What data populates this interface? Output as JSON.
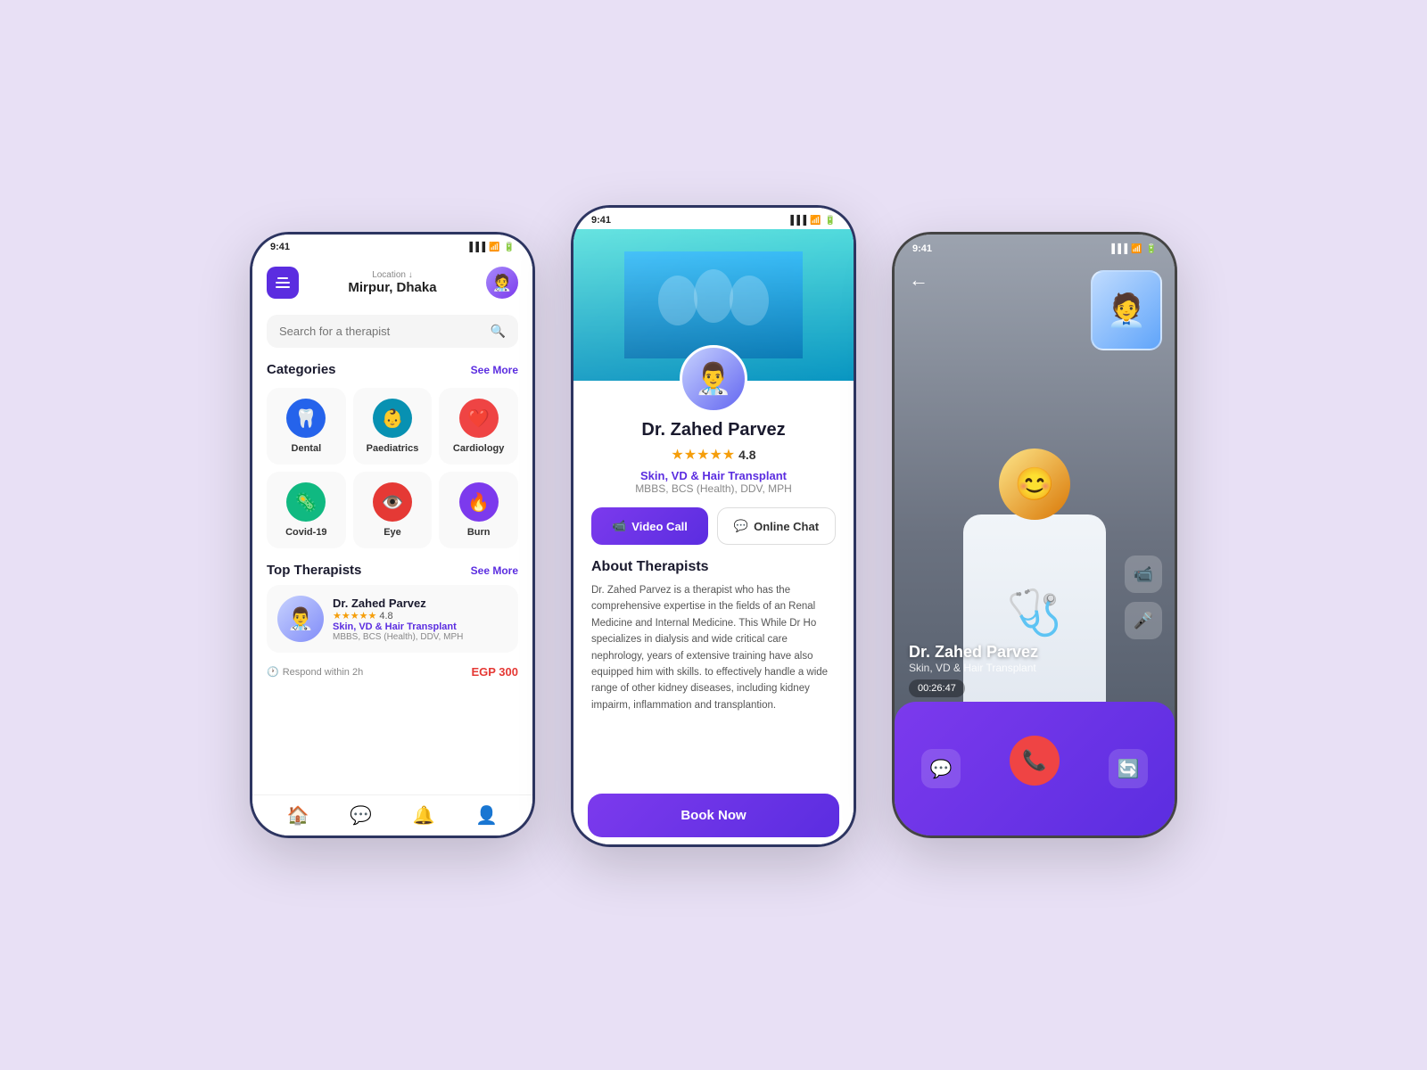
{
  "app": {
    "background_color": "#e8e0f5"
  },
  "phone1": {
    "status_time": "9:41",
    "header": {
      "location_label": "Location ↓",
      "location_name": "Mirpur, Dhaka"
    },
    "search": {
      "placeholder": "Search for a therapist"
    },
    "categories": {
      "title": "Categories",
      "see_more": "See More",
      "items": [
        {
          "name": "Dental",
          "icon": "🦷",
          "color": "#2563eb"
        },
        {
          "name": "Paediatrics",
          "icon": "👶",
          "color": "#0891b2"
        },
        {
          "name": "Cardiology",
          "icon": "❤️",
          "color": "#ef4444"
        },
        {
          "name": "Covid-19",
          "icon": "🦠",
          "color": "#10b981"
        },
        {
          "name": "Eye",
          "icon": "👁️",
          "color": "#e53935"
        },
        {
          "name": "Burn",
          "icon": "🔥",
          "color": "#7c3aed"
        }
      ]
    },
    "top_therapists": {
      "title": "Top Therapists",
      "see_more": "See More",
      "doctor": {
        "name": "Dr. Zahed Parvez",
        "rating": "4.8",
        "specialty": "Skin, VD & Hair Transplant",
        "qualifications": "MBBS, BCS (Health), DDV, MPH",
        "respond": "Respond within 2h",
        "price": "EGP 300"
      }
    },
    "nav": {
      "home": "🏠",
      "chat": "💬",
      "bell": "🔔",
      "person": "👤"
    }
  },
  "phone2": {
    "status_time": "9:41",
    "doctor": {
      "name": "Dr. Zahed Parvez",
      "rating": "4.8",
      "specialty": "Skin, VD & Hair Transplant",
      "qualifications": "MBBS, BCS (Health), DDV, MPH",
      "about_title": "About Therapists",
      "about_text": "Dr. Zahed Parvez is a therapist who has the comprehensive expertise in the fields of an Renal Medicine and Internal Medicine. This While Dr Ho specializes in dialysis and wide critical care nephrology, years of extensive training have also equipped him with skills. to effectively handle a wide range of other kidney diseases, including kidney impairm, inflammation and transplantion."
    },
    "actions": {
      "video_call": "Video Call",
      "online_chat": "Online Chat",
      "book_now": "Book Now"
    }
  },
  "phone3": {
    "status_time": "9:41",
    "doctor": {
      "name": "Dr. Zahed Parvez",
      "specialty": "Skin, VD & Hair Transplant",
      "call_timer": "00:26:47"
    },
    "controls": {
      "video_icon": "📹",
      "mic_icon": "🎤",
      "end_call": "📞",
      "chat_icon": "💬",
      "refresh_icon": "🔄"
    }
  }
}
